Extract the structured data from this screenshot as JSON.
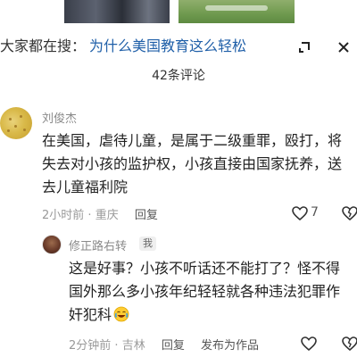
{
  "search": {
    "prefix": "大家都在搜：",
    "query": "为什么美国教育这么轻松"
  },
  "icons": {
    "expand": "expand-arrow-icon",
    "close": "close-icon",
    "like": "heart-icon",
    "dislike": "dislike-icon",
    "emoji": "crying-laughing-emoji-icon"
  },
  "comments_header": {
    "count_label": "42条评论"
  },
  "comment1": {
    "author": "刘俊杰",
    "lines": [
      "在美国，虐待儿童，是属于二级重罪，殴打，将",
      "失去对小孩的监护权，小孩直接由国家抚养，送",
      "去儿童福利院"
    ],
    "time": "2小时前",
    "separator": "·",
    "location": "重庆",
    "reply_label": "回复",
    "likes": "7"
  },
  "reply1": {
    "author": "修正路右转",
    "badge": "我",
    "lines": [
      "这是好事？小孩不听话还不能打了？怪不得",
      "国外那么多小孩年纪轻轻就各种违法犯罪作",
      "奸犯科"
    ],
    "time": "2分钟前",
    "separator": "·",
    "location": "吉林",
    "reply_label": "回复",
    "publish_label": "发布为作品"
  }
}
